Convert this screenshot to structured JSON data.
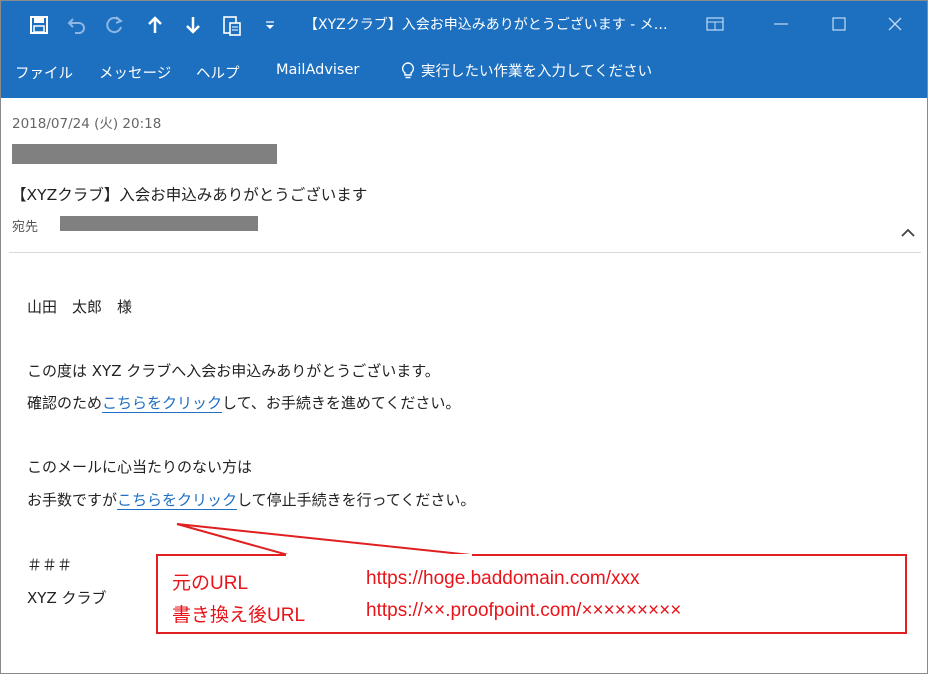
{
  "titlebar": {
    "title": "【XYZクラブ】入会お申込みありがとうございます  -  メ…",
    "icons": [
      "save-icon",
      "undo-icon",
      "redo-icon",
      "up-arrow-icon",
      "down-arrow-icon",
      "clipboard-icon",
      "quick-access-dropdown-icon"
    ],
    "window_controls": [
      "restore-ribbon-icon",
      "minimize-icon",
      "maximize-icon",
      "close-icon"
    ]
  },
  "ribbon": {
    "tabs": [
      {
        "label": "ファイル"
      },
      {
        "label": "メッセージ"
      },
      {
        "label": "ヘルプ"
      },
      {
        "label": "MailAdviser"
      }
    ],
    "tellme": "実行したい作業を入力してください"
  },
  "header": {
    "date": "2018/07/24 (火) 20:18",
    "subject": "【XYZクラブ】入会お申込みありがとうございます",
    "to_label": "宛先"
  },
  "body": {
    "greeting": "山田　太郎　様",
    "line1": "この度は XYZ クラブへ入会お申込みありがとうございます。",
    "line2_pre": "確認のため",
    "line2_link": "こちらをクリック",
    "line2_post": "して、お手続きを進めてください。",
    "line3": "このメールに心当たりのない方は",
    "line4_pre": "お手数ですが",
    "line4_link": "こちらをクリック",
    "line4_post": "して停止手続きを行ってください。",
    "sig1": "＃＃＃",
    "sig2": "XYZ クラブ"
  },
  "callout": {
    "row1_label": "元のURL",
    "row1_value": "https://hoge.baddomain.com/xxx",
    "row2_label": "書き換え後URL",
    "row2_value": "https://××.proofpoint.com/×××××××××",
    "color": "#e8141a"
  },
  "colors": {
    "accent": "#1d6fc0",
    "link": "#1f6fc5",
    "redaction": "#808080"
  }
}
